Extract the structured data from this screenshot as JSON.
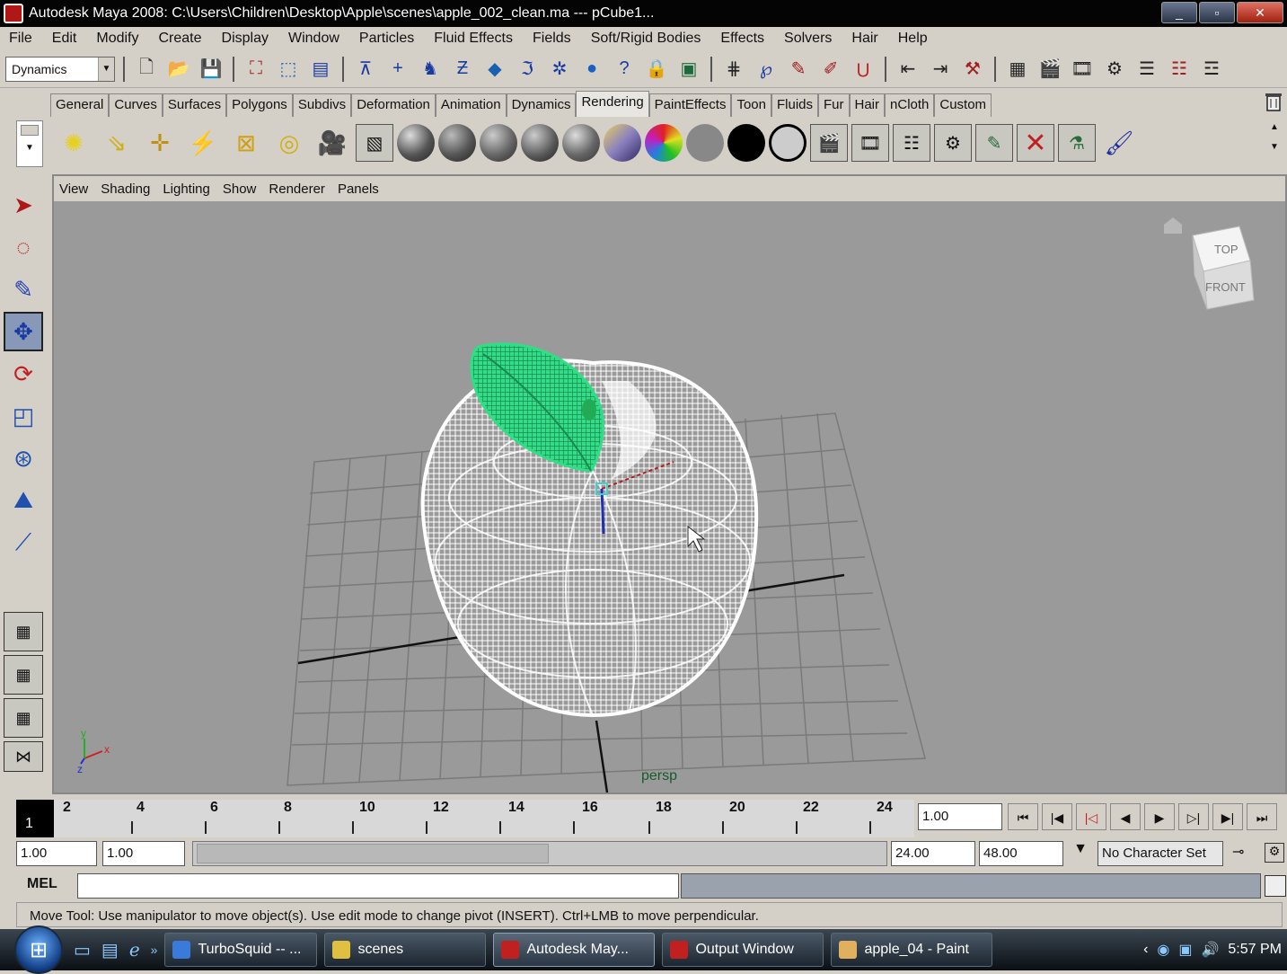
{
  "window": {
    "title": "Autodesk Maya 2008: C:\\Users\\Children\\Desktop\\Apple\\scenes\\apple_002_clean.ma   ---   pCube1...",
    "buttons": [
      "minimize",
      "maximize",
      "close"
    ]
  },
  "menubar": [
    "File",
    "Edit",
    "Modify",
    "Create",
    "Display",
    "Window",
    "Particles",
    "Fluid Effects",
    "Fields",
    "Soft/Rigid Bodies",
    "Effects",
    "Solvers",
    "Hair",
    "Help"
  ],
  "statusline": {
    "menuset": "Dynamics"
  },
  "shelf": {
    "tabs": [
      "General",
      "Curves",
      "Surfaces",
      "Polygons",
      "Subdivs",
      "Deformation",
      "Animation",
      "Dynamics",
      "Rendering",
      "PaintEffects",
      "Toon",
      "Fluids",
      "Fur",
      "Hair",
      "nCloth",
      "Custom"
    ],
    "active_tab": "Rendering"
  },
  "viewport": {
    "menus": [
      "View",
      "Shading",
      "Lighting",
      "Show",
      "Renderer",
      "Panels"
    ],
    "camera_label": "persp",
    "viewcube": {
      "top": "TOP",
      "front": "FRONT"
    },
    "axes": {
      "x": "x",
      "y": "y",
      "z": "z"
    }
  },
  "timeline": {
    "current_frame": "1",
    "tick_labels": [
      "2",
      "4",
      "6",
      "8",
      "10",
      "12",
      "14",
      "16",
      "18",
      "20",
      "22",
      "24"
    ],
    "current_time": "1.00",
    "playback_buttons": [
      "go-to-start",
      "step-back-key",
      "step-back-frame",
      "play-backward",
      "play-forward",
      "step-forward-frame",
      "step-forward-key",
      "go-to-end"
    ]
  },
  "range": {
    "anim_start": "1.00",
    "playback_start": "1.00",
    "playback_end": "24.00",
    "anim_end": "48.00",
    "character_set": "No Character Set"
  },
  "commandline": {
    "label": "MEL"
  },
  "helpline": "Move Tool: Use manipulator to move object(s). Use edit mode to change pivot (INSERT). Ctrl+LMB to move perpendicular.",
  "taskbar": {
    "tasks": [
      {
        "label": "TurboSquid -- ...",
        "color": "#3a7ad8"
      },
      {
        "label": "scenes",
        "color": "#e0c040"
      },
      {
        "label": "Autodesk May...",
        "color": "#c02020"
      },
      {
        "label": "Output Window",
        "color": "#c02020"
      },
      {
        "label": "apple_04 - Paint",
        "color": "#e0b060"
      }
    ],
    "active_task": 2,
    "clock": "5:57 PM"
  },
  "colors": {
    "viewport_bg": "#9a9a9a",
    "leaf": "#33dd88",
    "wireframe": "#ffffff"
  }
}
